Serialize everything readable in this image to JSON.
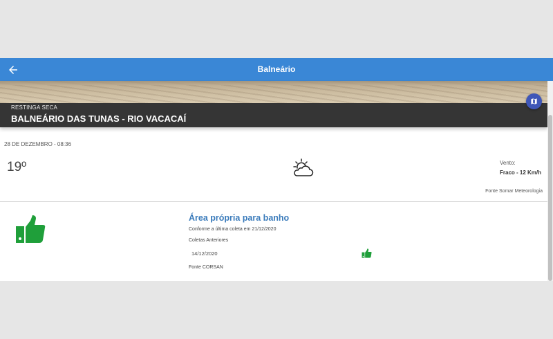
{
  "topbar": {
    "title": "Balneário"
  },
  "hero": {
    "subtitle": "RESTINGA SECA",
    "title": "BALNEÁRIO DAS TUNAS - RIO VACACAÍ"
  },
  "weather": {
    "datetime": "28 DE DEZEMBRO - 08:36",
    "temperature": "19º",
    "condition_icon": "partly-cloudy-icon",
    "wind_label": "Vento:",
    "wind_value": "Fraco - 12 Km/h",
    "source": "Fonte Somar Meteorologia"
  },
  "quality": {
    "status": "Área própria para banho",
    "last_collection": "Conforme a última coleta em 21/12/2020",
    "previous_label": "Coletas Anteriores",
    "previous": [
      {
        "date": "14/12/2020",
        "icon": "thumbs-up-icon"
      }
    ],
    "source": "Fonte CORSAN",
    "icon": "thumbs-up-icon"
  },
  "colors": {
    "topbar": "#3a87d6",
    "accent_green": "#1f9f3a",
    "status_blue": "#3a7bbb",
    "map_button": "#3f57b8",
    "hero_overlay": "#353535"
  }
}
